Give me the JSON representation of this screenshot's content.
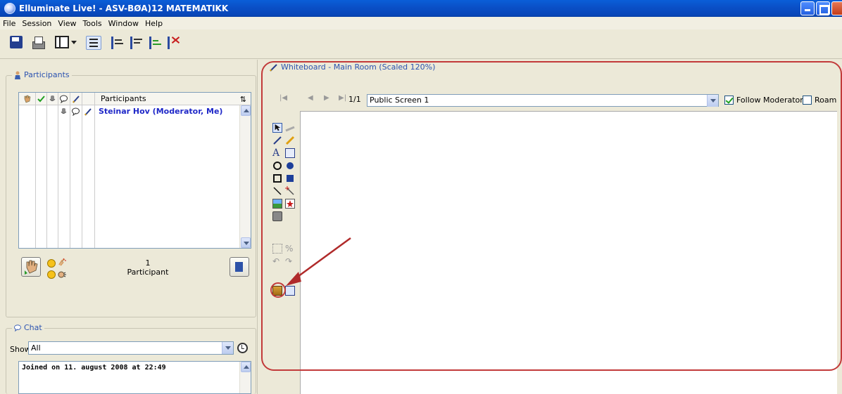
{
  "window": {
    "title": "Elluminate Live! - ASV-BØA)12 MATEMATIKK"
  },
  "menu": [
    "File",
    "Session",
    "View",
    "Tools",
    "Window",
    "Help"
  ],
  "participants": {
    "legend": "Participants",
    "column_header": "Participants",
    "rows": [
      {
        "name": "Steinar Hov (Moderator, Me)"
      }
    ],
    "count": "1",
    "count_label": "Participant"
  },
  "chat": {
    "legend": "Chat",
    "show_label": "Show",
    "filter_value": "All",
    "messages": [
      "Joined on 11. august 2008 at 22:49"
    ]
  },
  "whiteboard": {
    "legend": "Whiteboard - Main Room (Scaled 120%)",
    "page_indicator": "1/1",
    "screen": "Public Screen 1",
    "follow_moderator_label": "Follow Moderator",
    "follow_moderator": true,
    "roam_label": "Roam",
    "roam": false
  },
  "colors": {
    "title_bar": "#0a50c8",
    "accent": "#2c53b0",
    "annotation": "#c23a3a",
    "name_text": "#1f28c8"
  }
}
